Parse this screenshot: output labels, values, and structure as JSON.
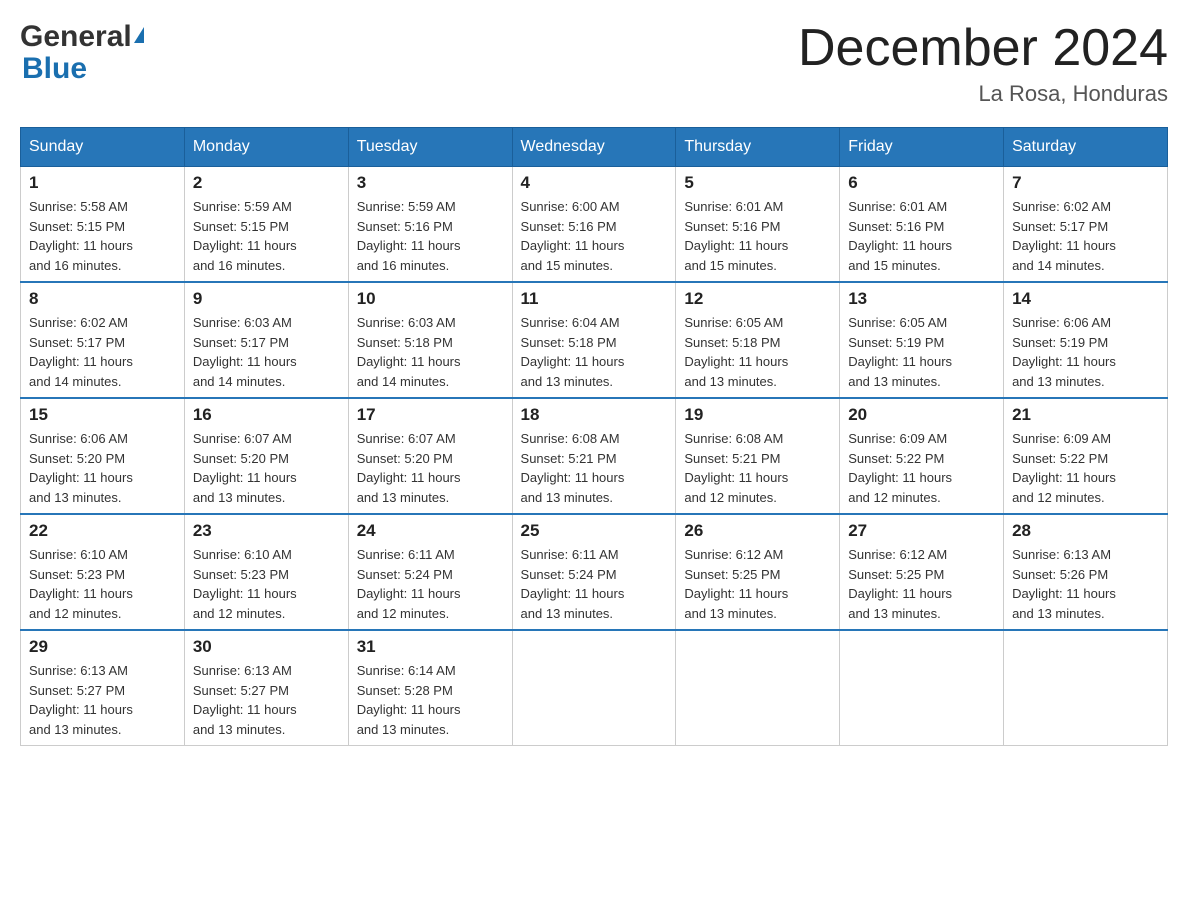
{
  "header": {
    "logo_general": "General",
    "logo_blue": "Blue",
    "month_title": "December 2024",
    "location": "La Rosa, Honduras"
  },
  "days_of_week": [
    "Sunday",
    "Monday",
    "Tuesday",
    "Wednesday",
    "Thursday",
    "Friday",
    "Saturday"
  ],
  "weeks": [
    [
      {
        "day": "1",
        "sunrise": "5:58 AM",
        "sunset": "5:15 PM",
        "daylight": "11 hours and 16 minutes."
      },
      {
        "day": "2",
        "sunrise": "5:59 AM",
        "sunset": "5:15 PM",
        "daylight": "11 hours and 16 minutes."
      },
      {
        "day": "3",
        "sunrise": "5:59 AM",
        "sunset": "5:16 PM",
        "daylight": "11 hours and 16 minutes."
      },
      {
        "day": "4",
        "sunrise": "6:00 AM",
        "sunset": "5:16 PM",
        "daylight": "11 hours and 15 minutes."
      },
      {
        "day": "5",
        "sunrise": "6:01 AM",
        "sunset": "5:16 PM",
        "daylight": "11 hours and 15 minutes."
      },
      {
        "day": "6",
        "sunrise": "6:01 AM",
        "sunset": "5:16 PM",
        "daylight": "11 hours and 15 minutes."
      },
      {
        "day": "7",
        "sunrise": "6:02 AM",
        "sunset": "5:17 PM",
        "daylight": "11 hours and 14 minutes."
      }
    ],
    [
      {
        "day": "8",
        "sunrise": "6:02 AM",
        "sunset": "5:17 PM",
        "daylight": "11 hours and 14 minutes."
      },
      {
        "day": "9",
        "sunrise": "6:03 AM",
        "sunset": "5:17 PM",
        "daylight": "11 hours and 14 minutes."
      },
      {
        "day": "10",
        "sunrise": "6:03 AM",
        "sunset": "5:18 PM",
        "daylight": "11 hours and 14 minutes."
      },
      {
        "day": "11",
        "sunrise": "6:04 AM",
        "sunset": "5:18 PM",
        "daylight": "11 hours and 13 minutes."
      },
      {
        "day": "12",
        "sunrise": "6:05 AM",
        "sunset": "5:18 PM",
        "daylight": "11 hours and 13 minutes."
      },
      {
        "day": "13",
        "sunrise": "6:05 AM",
        "sunset": "5:19 PM",
        "daylight": "11 hours and 13 minutes."
      },
      {
        "day": "14",
        "sunrise": "6:06 AM",
        "sunset": "5:19 PM",
        "daylight": "11 hours and 13 minutes."
      }
    ],
    [
      {
        "day": "15",
        "sunrise": "6:06 AM",
        "sunset": "5:20 PM",
        "daylight": "11 hours and 13 minutes."
      },
      {
        "day": "16",
        "sunrise": "6:07 AM",
        "sunset": "5:20 PM",
        "daylight": "11 hours and 13 minutes."
      },
      {
        "day": "17",
        "sunrise": "6:07 AM",
        "sunset": "5:20 PM",
        "daylight": "11 hours and 13 minutes."
      },
      {
        "day": "18",
        "sunrise": "6:08 AM",
        "sunset": "5:21 PM",
        "daylight": "11 hours and 13 minutes."
      },
      {
        "day": "19",
        "sunrise": "6:08 AM",
        "sunset": "5:21 PM",
        "daylight": "11 hours and 12 minutes."
      },
      {
        "day": "20",
        "sunrise": "6:09 AM",
        "sunset": "5:22 PM",
        "daylight": "11 hours and 12 minutes."
      },
      {
        "day": "21",
        "sunrise": "6:09 AM",
        "sunset": "5:22 PM",
        "daylight": "11 hours and 12 minutes."
      }
    ],
    [
      {
        "day": "22",
        "sunrise": "6:10 AM",
        "sunset": "5:23 PM",
        "daylight": "11 hours and 12 minutes."
      },
      {
        "day": "23",
        "sunrise": "6:10 AM",
        "sunset": "5:23 PM",
        "daylight": "11 hours and 12 minutes."
      },
      {
        "day": "24",
        "sunrise": "6:11 AM",
        "sunset": "5:24 PM",
        "daylight": "11 hours and 12 minutes."
      },
      {
        "day": "25",
        "sunrise": "6:11 AM",
        "sunset": "5:24 PM",
        "daylight": "11 hours and 13 minutes."
      },
      {
        "day": "26",
        "sunrise": "6:12 AM",
        "sunset": "5:25 PM",
        "daylight": "11 hours and 13 minutes."
      },
      {
        "day": "27",
        "sunrise": "6:12 AM",
        "sunset": "5:25 PM",
        "daylight": "11 hours and 13 minutes."
      },
      {
        "day": "28",
        "sunrise": "6:13 AM",
        "sunset": "5:26 PM",
        "daylight": "11 hours and 13 minutes."
      }
    ],
    [
      {
        "day": "29",
        "sunrise": "6:13 AM",
        "sunset": "5:27 PM",
        "daylight": "11 hours and 13 minutes."
      },
      {
        "day": "30",
        "sunrise": "6:13 AM",
        "sunset": "5:27 PM",
        "daylight": "11 hours and 13 minutes."
      },
      {
        "day": "31",
        "sunrise": "6:14 AM",
        "sunset": "5:28 PM",
        "daylight": "11 hours and 13 minutes."
      },
      null,
      null,
      null,
      null
    ]
  ],
  "labels": {
    "sunrise": "Sunrise:",
    "sunset": "Sunset:",
    "daylight": "Daylight:"
  }
}
